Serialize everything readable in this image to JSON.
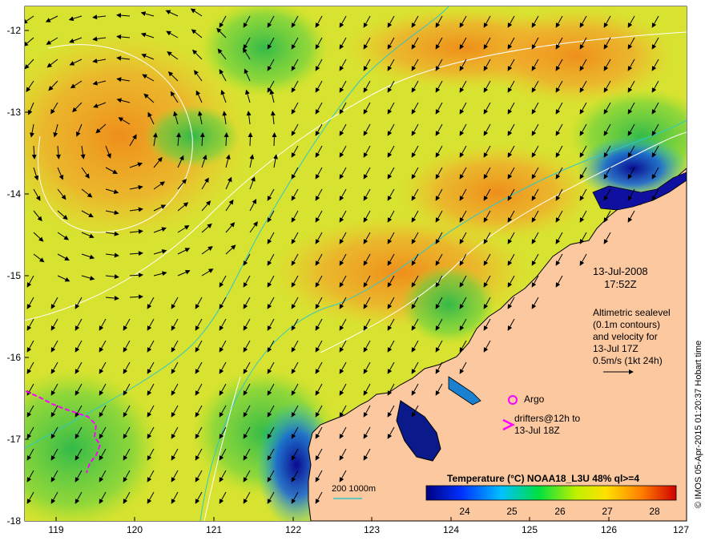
{
  "map": {
    "y_ticks": [
      "-12",
      "-13",
      "-14",
      "-15",
      "-16",
      "-17",
      "-18"
    ],
    "x_ticks": [
      "119",
      "120",
      "121",
      "122",
      "123",
      "124",
      "125",
      "126",
      "127"
    ],
    "date": "13-Jul-2008",
    "time": "17:52Z",
    "altimetry_lines": [
      "Altimetric sealevel",
      "(0.1m contours)",
      "and velocity for",
      "13-Jul 17Z",
      "0.5m/s (1kt 24h)"
    ],
    "argo_label": "Argo",
    "drifter_label_1": "drifters@12h to",
    "drifter_label_2": "13-Jul 18Z",
    "colorbar_title": "Temperature (°C) NOAA18_L3U 48% ql>=4",
    "colorbar_ticks": [
      "24",
      "25",
      "26",
      "27",
      "28"
    ],
    "scale_label": "200  1000m",
    "credit": "© IMOS 05-Apr-2015 01:20:37 Hobart time"
  },
  "colors": {
    "land": "#fbc8a0",
    "contour": "#ffffff",
    "bathymetry": "#2ec8c8",
    "drifter": "#ff00ff",
    "arrow": "#000000"
  },
  "icons": [
    "argo-circle-icon",
    "drifter-chevron-icon",
    "velocity-scale-arrow-icon"
  ]
}
